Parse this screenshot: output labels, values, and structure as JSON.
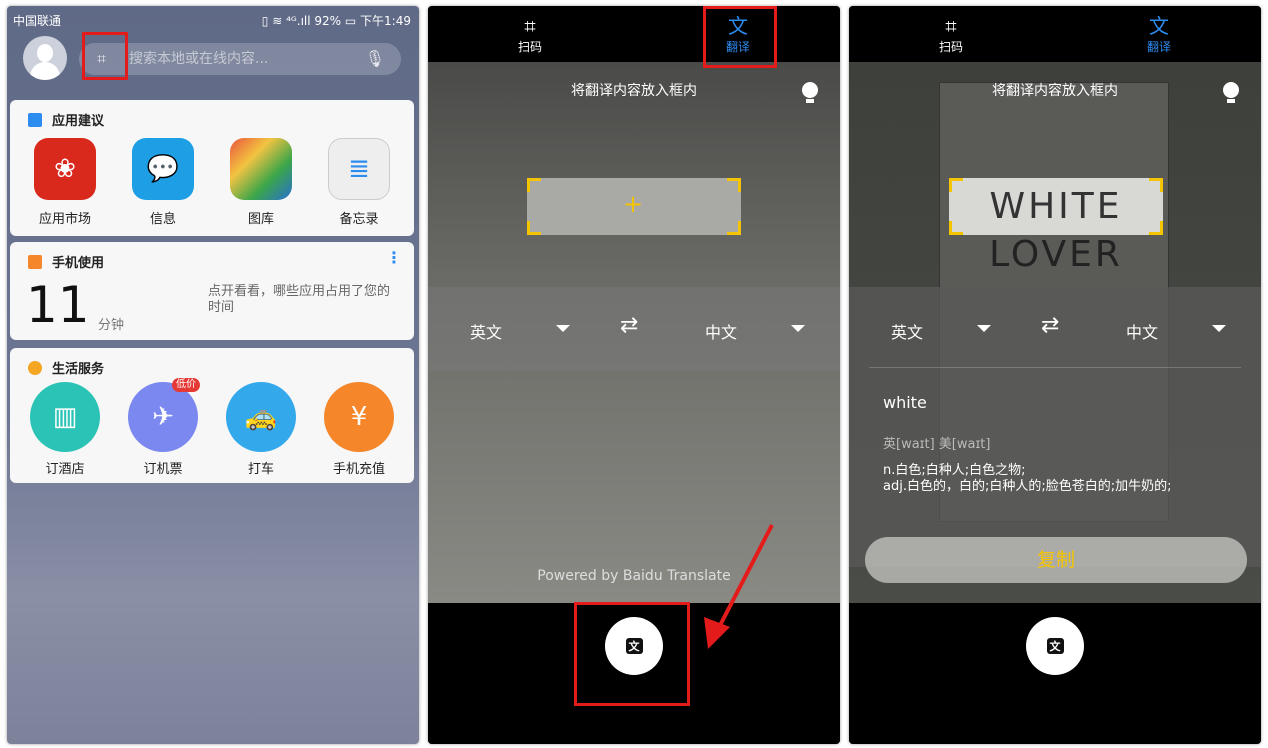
{
  "panel1": {
    "status": {
      "carrier": "中国联通",
      "icons": "▯ ≋ ⁴ᴳ.ıll",
      "battery": "92%",
      "time": "下午1:49"
    },
    "search": {
      "placeholder": "搜索本地或在线内容..."
    },
    "app_suggestions": {
      "title": "应用建议",
      "apps": [
        {
          "label": "应用市场",
          "color": "#d9291c"
        },
        {
          "label": "信息",
          "color": "#1e9fe5"
        },
        {
          "label": "图库",
          "color": "#c9a060"
        },
        {
          "label": "备忘录",
          "color": "#eeeeee"
        }
      ]
    },
    "phone_usage": {
      "title": "手机使用",
      "value": "11",
      "unit": "分钟",
      "note": "点开看看，哪些应用占用了您的时间",
      "more": "⋮"
    },
    "life_services": {
      "title": "生活服务",
      "apps": [
        {
          "label": "订酒店",
          "color": "#2bc3b6",
          "glyph": "▥"
        },
        {
          "label": "订机票",
          "color": "#7a88f0",
          "glyph": "✈",
          "badge": "低价"
        },
        {
          "label": "打车",
          "color": "#33a8ea",
          "glyph": "🚕"
        },
        {
          "label": "手机充值",
          "color": "#f5862a",
          "glyph": "¥"
        }
      ]
    }
  },
  "translate": {
    "tabs": [
      {
        "label": "扫码",
        "glyph": "⌗"
      },
      {
        "label": "翻译",
        "glyph": "文"
      }
    ],
    "active_color": "#2d8cf0",
    "hint": "将翻译内容放入框内",
    "source_lang": "英文",
    "target_lang": "中文",
    "swap": "⇄",
    "powered_by": "Powered by Baidu Translate",
    "fab_glyph": "文"
  },
  "result": {
    "captured_text": [
      "WHITE",
      "LOVER"
    ],
    "word": "white",
    "phonetic": "英[waɪt] 美[waɪt]",
    "definitions": [
      "n.白色;白种人;白色之物;",
      "adj.白色的，白的;白种人的;脸色苍白的;加牛奶的;"
    ],
    "copy_label": "复制"
  }
}
